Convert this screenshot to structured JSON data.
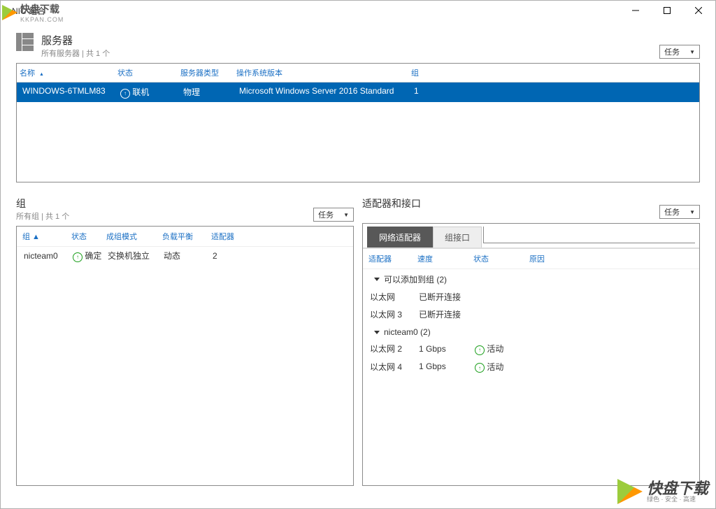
{
  "window": {
    "title": "NIC 组合"
  },
  "watermark": {
    "brand": "快盘下载",
    "site": "KKPAN.COM",
    "footer_brand": "快盘下载",
    "footer_sub": "绿色 · 安全 · 高速"
  },
  "task_label": "任务",
  "servers": {
    "title": "服务器",
    "subtitle": "所有服务器 | 共 1 个",
    "columns": {
      "name": "名称",
      "status": "状态",
      "type": "服务器类型",
      "os": "操作系统版本",
      "team": "组"
    },
    "rows": [
      {
        "name": "WINDOWS-6TMLM83",
        "status": "联机",
        "type": "物理",
        "os": "Microsoft Windows Server 2016 Standard",
        "team": "1"
      }
    ]
  },
  "teams": {
    "title": "组",
    "subtitle": "所有组 | 共 1 个",
    "columns": {
      "team": "组",
      "status": "状态",
      "mode": "成组模式",
      "lb": "负载平衡",
      "adapters": "适配器"
    },
    "rows": [
      {
        "team": "nicteam0",
        "status": "确定",
        "mode": "交换机独立",
        "lb": "动态",
        "adapters": "2"
      }
    ]
  },
  "adapters": {
    "title": "适配器和接口",
    "tabs": {
      "net": "网络适配器",
      "iface": "组接口"
    },
    "columns": {
      "adapter": "适配器",
      "speed": "速度",
      "status": "状态",
      "reason": "原因"
    },
    "groups": [
      {
        "header": "可以添加到组 (2)",
        "rows": [
          {
            "adapter": "以太网",
            "speed": "已断开连接",
            "status": "",
            "reason": ""
          },
          {
            "adapter": "以太网 3",
            "speed": "已断开连接",
            "status": "",
            "reason": ""
          }
        ]
      },
      {
        "header": "nicteam0 (2)",
        "rows": [
          {
            "adapter": "以太网 2",
            "speed": "1 Gbps",
            "status": "活动",
            "reason": "",
            "icon": true
          },
          {
            "adapter": "以太网 4",
            "speed": "1 Gbps",
            "status": "活动",
            "reason": "",
            "icon": true
          }
        ]
      }
    ]
  }
}
